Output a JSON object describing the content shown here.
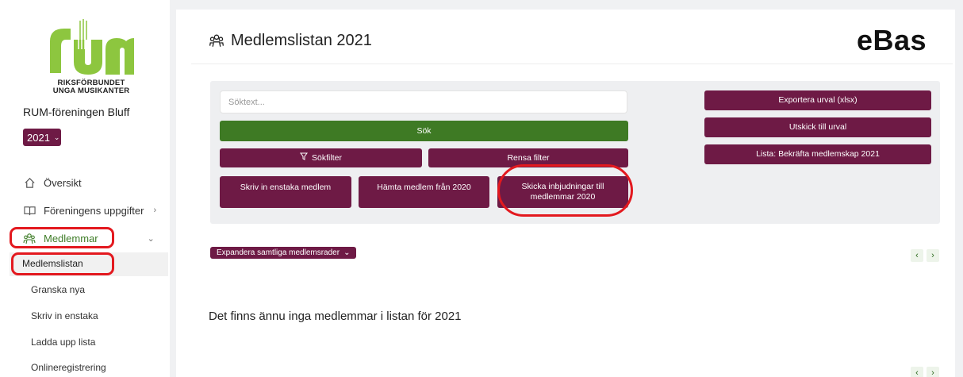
{
  "sidebar": {
    "logo_text_line1": "RIKSFÖRBUNDET",
    "logo_text_line2": "UNGA MUSIKANTER",
    "org_name": "RUM-föreningen Bluff",
    "year": "2021",
    "nav": {
      "overview": "Översikt",
      "association": "Föreningens uppgifter",
      "members": "Medlemmar"
    },
    "sub_items": {
      "member_list": "Medlemslistan",
      "review_new": "Granska nya",
      "write_single": "Skriv in enstaka",
      "upload_list": "Ladda upp lista",
      "online_registration": "Onlineregistrering"
    }
  },
  "header": {
    "title": "Medlemslistan 2021",
    "brand": "eBas"
  },
  "search": {
    "placeholder": "Söktext...",
    "search_label": "Sök",
    "filter_label": "Sökfilter",
    "clear_filter_label": "Rensa filter",
    "write_member_label": "Skriv in enstaka medlem",
    "fetch_members_label": "Hämta medlem från 2020",
    "send_invites_line1": "Skicka inbjudningar till",
    "send_invites_line2": "medlemmar 2020"
  },
  "actions": {
    "export_label": "Exportera urval (xlsx)",
    "send_label": "Utskick till urval",
    "confirm_label": "Lista: Bekräfta medlemskap 2021"
  },
  "list": {
    "expand_label": "Expandera samtliga medlemsrader",
    "empty_message": "Det finns ännu inga medlemmar i listan för 2021",
    "prev": "‹",
    "next": "›"
  },
  "colors": {
    "primary": "#6e1a45",
    "green": "#3e7a24",
    "annotation": "#e3191f"
  }
}
